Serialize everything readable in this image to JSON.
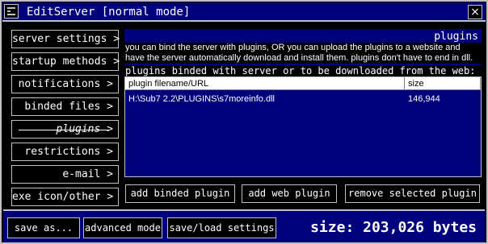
{
  "window": {
    "title": "EditServer [normal mode]",
    "close_glyph": "×"
  },
  "nav": {
    "items": [
      {
        "label": "server settings >"
      },
      {
        "label": "startup methods >"
      },
      {
        "label": "notifications >"
      },
      {
        "label": "binded files >"
      },
      {
        "label": "plugins >",
        "active": true
      },
      {
        "label": "restrictions >"
      },
      {
        "label": "e-mail >"
      },
      {
        "label": "exe icon/other >"
      }
    ]
  },
  "panel": {
    "heading": "plugins",
    "description": "you can bind the server with plugins, OR you can upload the plugins to a website and have the server automatically download and install them. plugins don't have to end in dll.",
    "list_heading": "plugins binded with server or to be downloaded from the web:",
    "columns": {
      "filename": "plugin filename/URL",
      "size": "size"
    },
    "rows": [
      {
        "filename": "H:\\Sub7 2.2\\PLUGINS\\s7moreinfo.dll",
        "size": "146,944"
      }
    ]
  },
  "actions": {
    "add_binded": "add binded plugin",
    "add_web": "add web plugin",
    "remove_selected": "remove selected plugin"
  },
  "footer": {
    "save_as": "save as...",
    "advanced_mode": "advanced mode",
    "save_load": "save/load settings",
    "size_text": "size: 203,026 bytes"
  },
  "colors": {
    "window_bg": "#000000",
    "accent_blue": "#00007a",
    "border": "#c0c0c0",
    "text": "#ffffff"
  }
}
